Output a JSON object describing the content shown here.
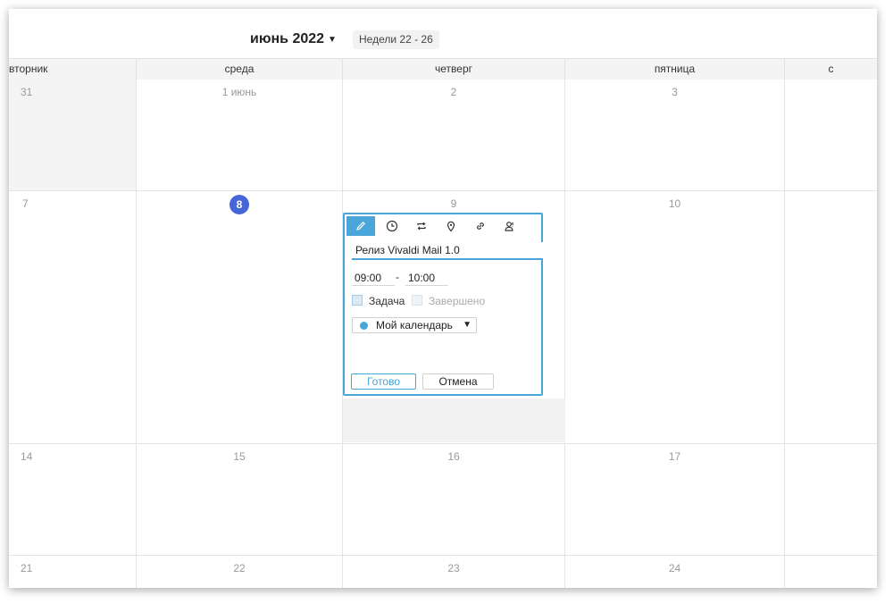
{
  "header": {
    "month_title": "июнь 2022",
    "weeks_badge": "Недели 22 - 26"
  },
  "day_headers": [
    "вторник",
    "среда",
    "четверг",
    "пятница",
    "с"
  ],
  "weeks": [
    [
      "31",
      "1 июнь",
      "2",
      "3",
      ""
    ],
    [
      "7",
      "8",
      "9",
      "10",
      ""
    ],
    [
      "14",
      "15",
      "16",
      "17",
      ""
    ],
    [
      "21",
      "22",
      "23",
      "24",
      ""
    ]
  ],
  "today": "8",
  "editor": {
    "tools": [
      "pencil-icon",
      "clock-icon",
      "repeat-icon",
      "location-pin-icon",
      "link-icon",
      "attendees-icon"
    ],
    "title_value": "Релиз Vivaldi Mail 1.0",
    "start_time": "09:00",
    "time_separator": "-",
    "end_time": "10:00",
    "task_label": "Задача",
    "completed_label": "Завершено",
    "calendar_name": "Мой календарь",
    "calendar_color": "#4aa5d8",
    "done_label": "Готово",
    "cancel_label": "Отмена"
  },
  "colors": {
    "accent": "#4aa5d8",
    "today": "#4666d8"
  }
}
